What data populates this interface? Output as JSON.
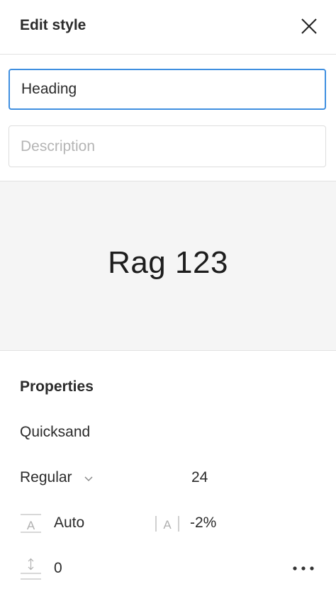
{
  "header": {
    "title": "Edit style",
    "close_icon": "close-icon"
  },
  "form": {
    "name_value": "Heading",
    "description_value": "",
    "description_placeholder": "Description",
    "focus_color": "#3f8fe0"
  },
  "preview": {
    "text": "Rag 123",
    "background": "#f5f5f5"
  },
  "properties": {
    "title": "Properties",
    "font_family": "Quicksand",
    "font_weight": "Regular",
    "font_size": "24",
    "line_height": "Auto",
    "letter_spacing": "-2%",
    "paragraph_spacing": "0",
    "icons": {
      "weight": "chevron-down-icon",
      "line_height": "line-height-icon",
      "letter_spacing": "letter-spacing-icon",
      "paragraph_spacing": "paragraph-spacing-icon",
      "more": "more-options-icon"
    }
  }
}
